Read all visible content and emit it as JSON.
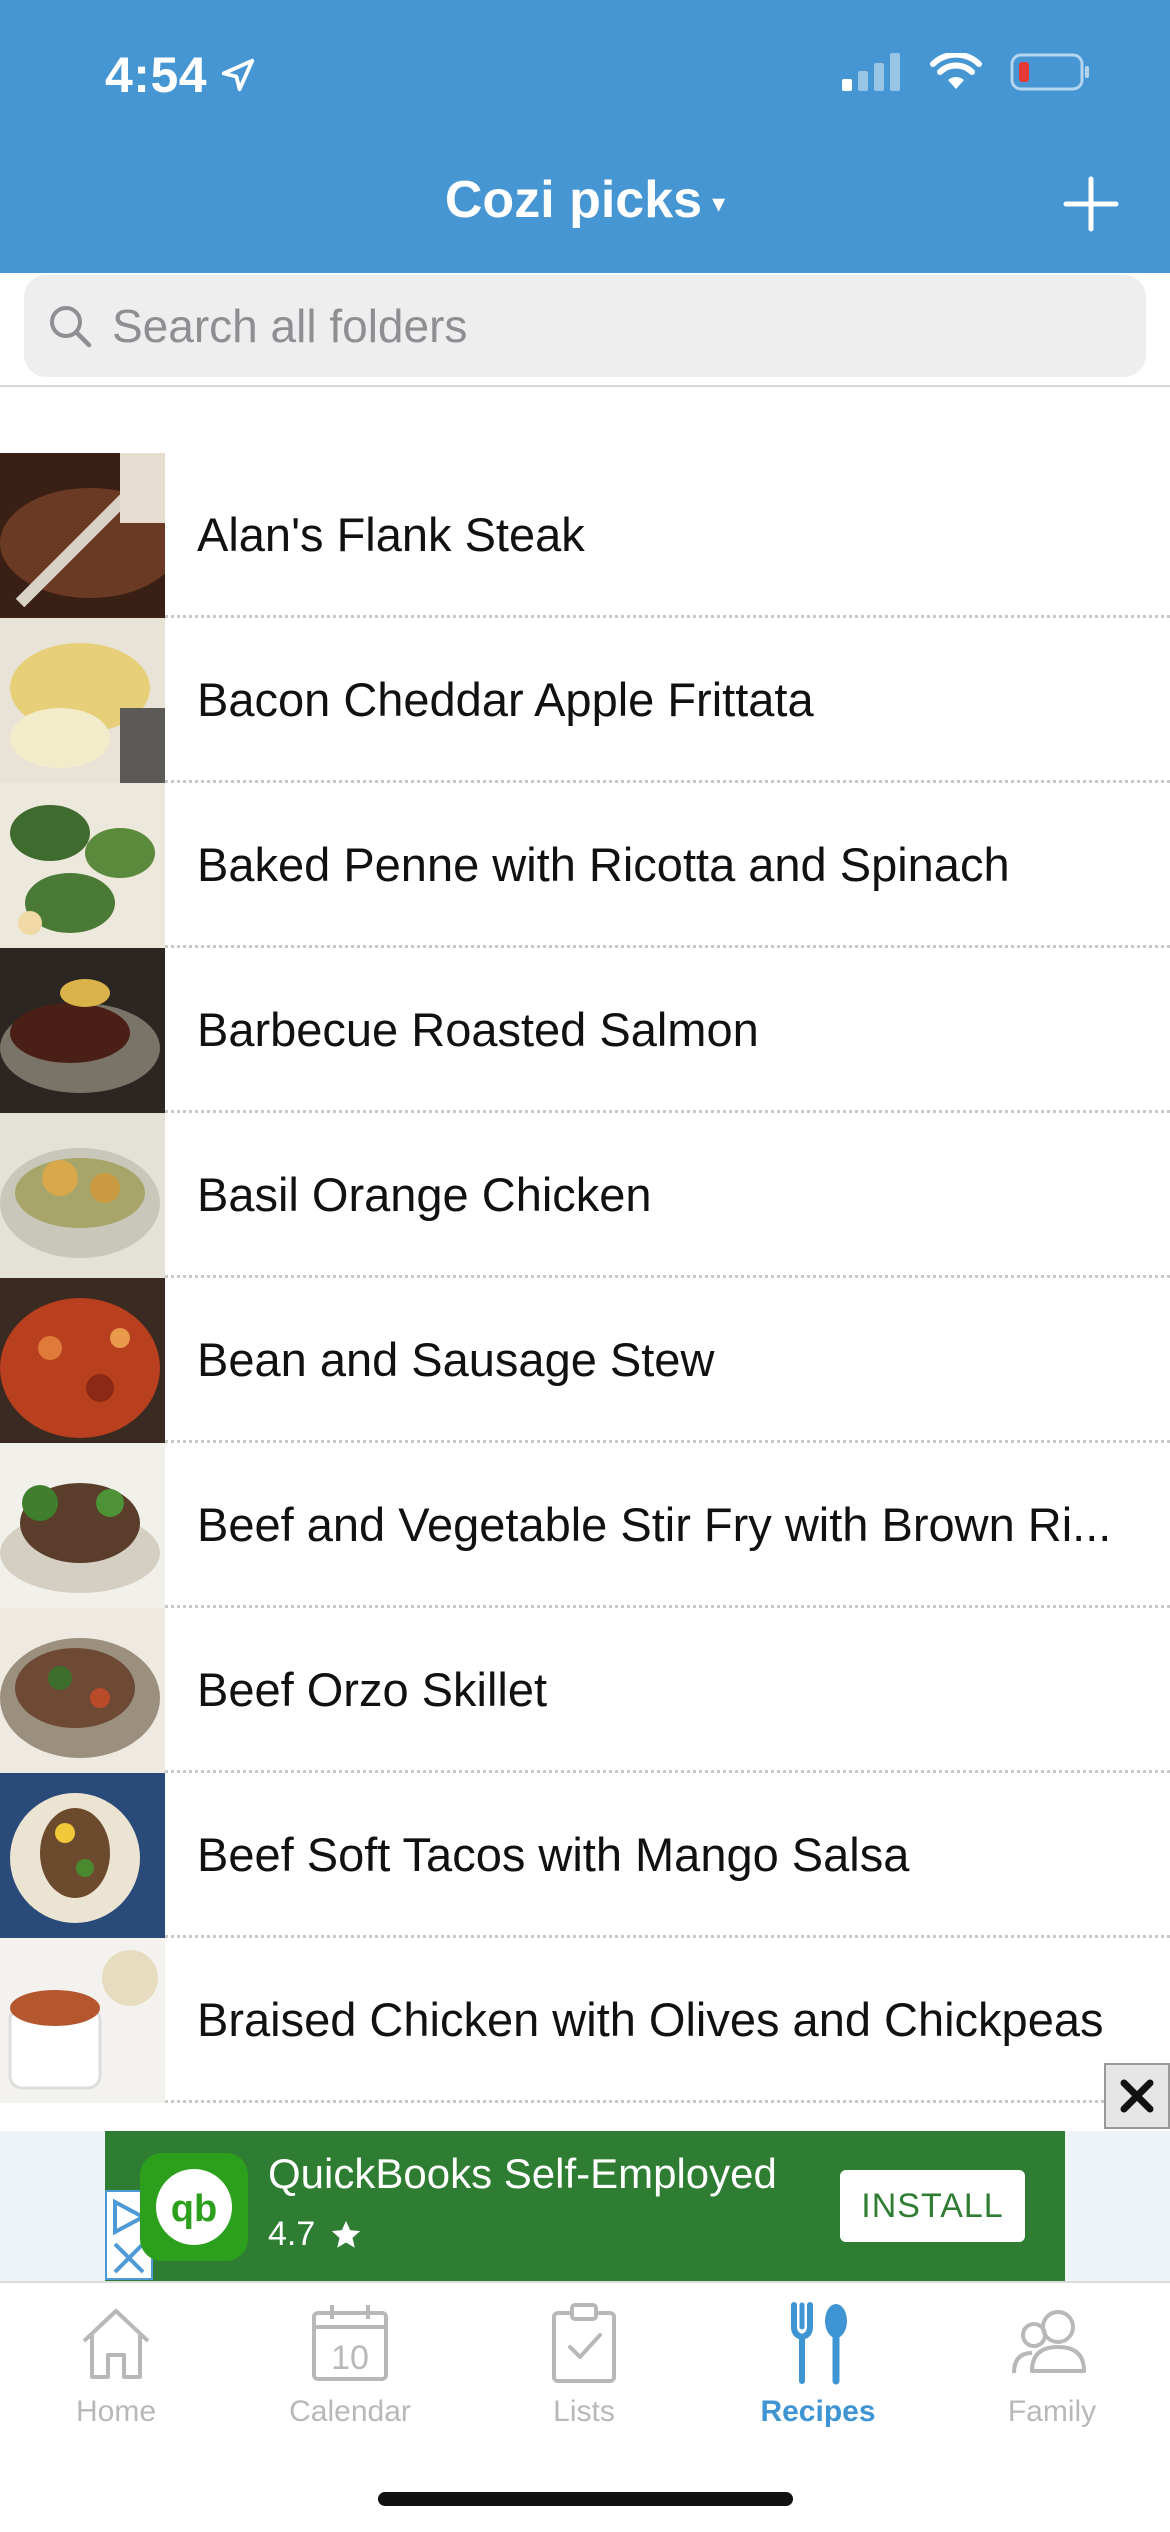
{
  "status_bar": {
    "time": "4:54",
    "icons": [
      "location-arrow-icon",
      "signal-icon",
      "wifi-icon",
      "battery-low-icon"
    ]
  },
  "nav": {
    "title": "Cozi picks",
    "caret": "▾",
    "add_icon": "plus-icon"
  },
  "search": {
    "placeholder": "Search all folders",
    "value": ""
  },
  "recipes": [
    {
      "name": "Alan's Flank Steak"
    },
    {
      "name": "Bacon Cheddar Apple Frittata"
    },
    {
      "name": "Baked Penne with Ricotta and Spinach"
    },
    {
      "name": "Barbecue Roasted Salmon"
    },
    {
      "name": "Basil Orange Chicken"
    },
    {
      "name": "Bean and Sausage Stew"
    },
    {
      "name": "Beef and Vegetable Stir Fry with Brown Ri..."
    },
    {
      "name": "Beef Orzo Skillet"
    },
    {
      "name": "Beef Soft Tacos with Mango Salsa"
    },
    {
      "name": "Braised Chicken with Olives and Chickpeas"
    }
  ],
  "ad": {
    "title": "QuickBooks Self-Employed",
    "rating": "4.7",
    "install_label": "INSTALL",
    "close_label": "✕",
    "logo_text": "qb"
  },
  "tabs": [
    {
      "label": "Home",
      "icon": "home-icon",
      "active": false
    },
    {
      "label": "Calendar",
      "icon": "calendar-icon",
      "date": "10",
      "active": false
    },
    {
      "label": "Lists",
      "icon": "clipboard-check-icon",
      "active": false
    },
    {
      "label": "Recipes",
      "icon": "fork-spoon-icon",
      "active": true
    },
    {
      "label": "Family",
      "icon": "people-icon",
      "active": false
    }
  ],
  "colors": {
    "header": "#4596d2",
    "accent": "#3f95d3",
    "ad_background": "#2e7d32"
  }
}
